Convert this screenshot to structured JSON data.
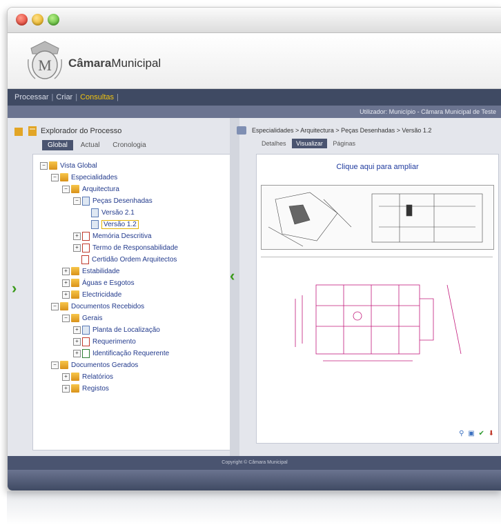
{
  "header": {
    "brand_part1": "Câmara",
    "brand_part2": "Municipal"
  },
  "nav": {
    "items": [
      "Processar",
      "Criar",
      "Consultas"
    ],
    "active": "Consultas"
  },
  "subbar": {
    "text": "Utilizador: Município - Câmara Municipal de Teste"
  },
  "explorer": {
    "title": "Explorador do Processo",
    "tabs": [
      "Global",
      "Actual",
      "Cronologia"
    ]
  },
  "tree": {
    "vista_global": "Vista Global",
    "especialidades": "Especialidades",
    "arquitectura": "Arquitectura",
    "pecas_desenhadas": "Peças Desenhadas",
    "versao_21": "Versão 2.1",
    "versao_12": "Versão 1.2",
    "memoria_descritiva": "Memória Descritiva",
    "termo_responsabilidade": "Termo de Responsabilidade",
    "certidao_ordem": "Certidão Ordem Arquitectos",
    "estabilidade": "Estabilidade",
    "aguas_esgotos": "Águas e Esgotos",
    "electricidade": "Electricidade",
    "documentos_recebidos": "Documentos Recebidos",
    "gerais": "Gerais",
    "planta_localizacao": "Planta de Localização",
    "requerimento": "Requerimento",
    "identificacao_requerente": "Identificação Requerente",
    "documentos_gerados": "Documentos Gerados",
    "relatorios": "Relatórios",
    "registos": "Registos"
  },
  "viewer": {
    "breadcrumb": "Especialidades > Arquitectura > Peças Desenhadas > Versão 1.2",
    "tabs": [
      "Detalhes",
      "Visualizar",
      "Páginas"
    ],
    "zoom_link": "Clique aqui para ampliar"
  },
  "footer": {
    "text": "Copyright © Câmara Municipal"
  }
}
